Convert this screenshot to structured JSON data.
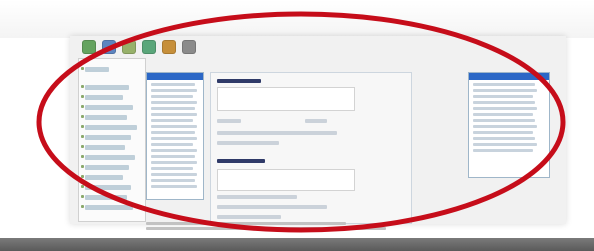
{
  "colors": {
    "annotation_ellipse": "#c60d1a",
    "selection_blue": "#2b67c6",
    "footer_gray": "#6b6b6b"
  },
  "toolbar": {
    "icons": [
      {
        "name": "monitor-icon"
      },
      {
        "name": "window-icon"
      },
      {
        "name": "sheet-icon"
      },
      {
        "name": "tools-icon"
      },
      {
        "name": "gear-icon"
      },
      {
        "name": "help-icon"
      }
    ]
  }
}
